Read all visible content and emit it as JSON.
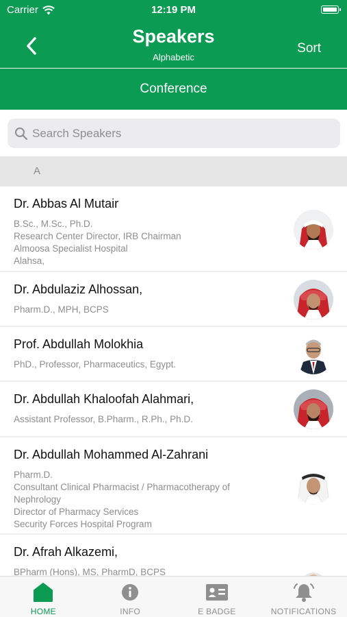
{
  "status_bar": {
    "carrier": "Carrier",
    "time": "12:19 PM"
  },
  "nav": {
    "title": "Speakers",
    "subtitle": "Alphabetic",
    "sort_label": "Sort",
    "back_icon": "chevron-left-icon"
  },
  "segment": {
    "label": "Conference"
  },
  "search": {
    "placeholder": "Search Speakers",
    "value": ""
  },
  "sections": [
    {
      "letter": "A",
      "speakers": [
        {
          "name": "Dr. Abbas Al Mutair",
          "details": "B.Sc., M.Sc., Ph.D.\nResearch Center Director, IRB Chairman\nAlmoosa Specialist Hospital\nAlahsa,",
          "photo": "speaker-photo-icon"
        },
        {
          "name": "Dr. Abdulaziz Alhossan,",
          "details": "Pharm.D., MPH, BCPS",
          "photo": "speaker-photo-icon"
        },
        {
          "name": "Prof. Abdullah Molokhia",
          "details": "PhD., Professor, Pharmaceutics, Egypt.",
          "photo": "speaker-photo-icon"
        },
        {
          "name": "Dr. Abdullah Khaloofah Alahmari,",
          "details": "Assistant Professor, B.Pharm., R.Ph., Ph.D.",
          "photo": "speaker-photo-icon"
        },
        {
          "name": "Dr. Abdullah Mohammed Al-Zahrani",
          "details": "Pharm.D.\nConsultant Clinical Pharmacist / Pharmacotherapy of\nNephrology\nDirector of Pharmacy Services\nSecurity Forces Hospital Program",
          "photo": "speaker-photo-icon"
        },
        {
          "name": "Dr. Afrah Alkazemi,",
          "details": "BPharm (Hons), MS, PharmD, BCPS",
          "photo": "speaker-photo-icon"
        }
      ]
    }
  ],
  "tabs": [
    {
      "label": "HOME",
      "icon": "home-icon",
      "active": true
    },
    {
      "label": "INFO",
      "icon": "info-icon",
      "active": false
    },
    {
      "label": "E BADGE",
      "icon": "badge-icon",
      "active": false
    },
    {
      "label": "NOTIFICATIONS",
      "icon": "bell-icon",
      "active": false
    }
  ],
  "colors": {
    "primary": "#0c9b52",
    "section_bg": "#e6e6e6",
    "secondary_text": "#8d8d8d"
  }
}
